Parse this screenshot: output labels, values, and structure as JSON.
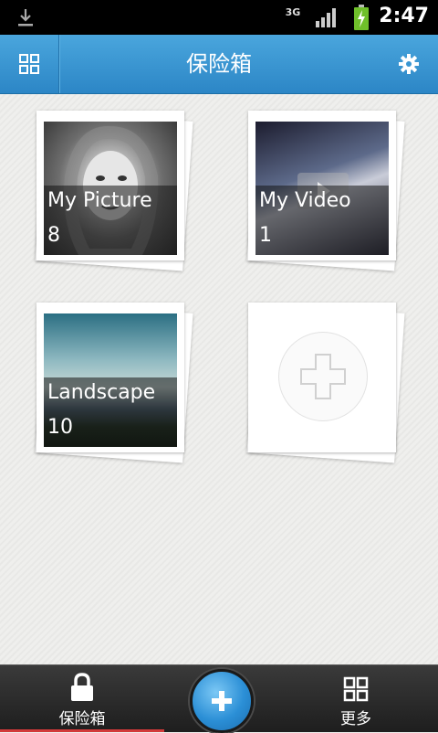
{
  "status_bar": {
    "network": "3G",
    "time": "2:47",
    "download_icon": "download-icon",
    "signal_icon": "signal-icon",
    "battery_icon": "battery-charging-icon"
  },
  "header": {
    "title": "保险箱",
    "left_icon": "grid-icon",
    "right_icon": "gear-icon"
  },
  "albums": [
    {
      "name": "My Picture",
      "count": "8"
    },
    {
      "name": "My Video",
      "count": "1"
    },
    {
      "name": "Landscape",
      "count": "10"
    }
  ],
  "add_album_icon": "plus-icon",
  "bottom_nav": {
    "items": [
      {
        "label": "保险箱",
        "icon": "lock-icon",
        "active": true
      },
      {
        "label": "更多",
        "icon": "grid-icon"
      }
    ],
    "fab_icon": "plus-icon"
  },
  "colors": {
    "header": "#2c86c6",
    "accent": "#d23a3a"
  }
}
